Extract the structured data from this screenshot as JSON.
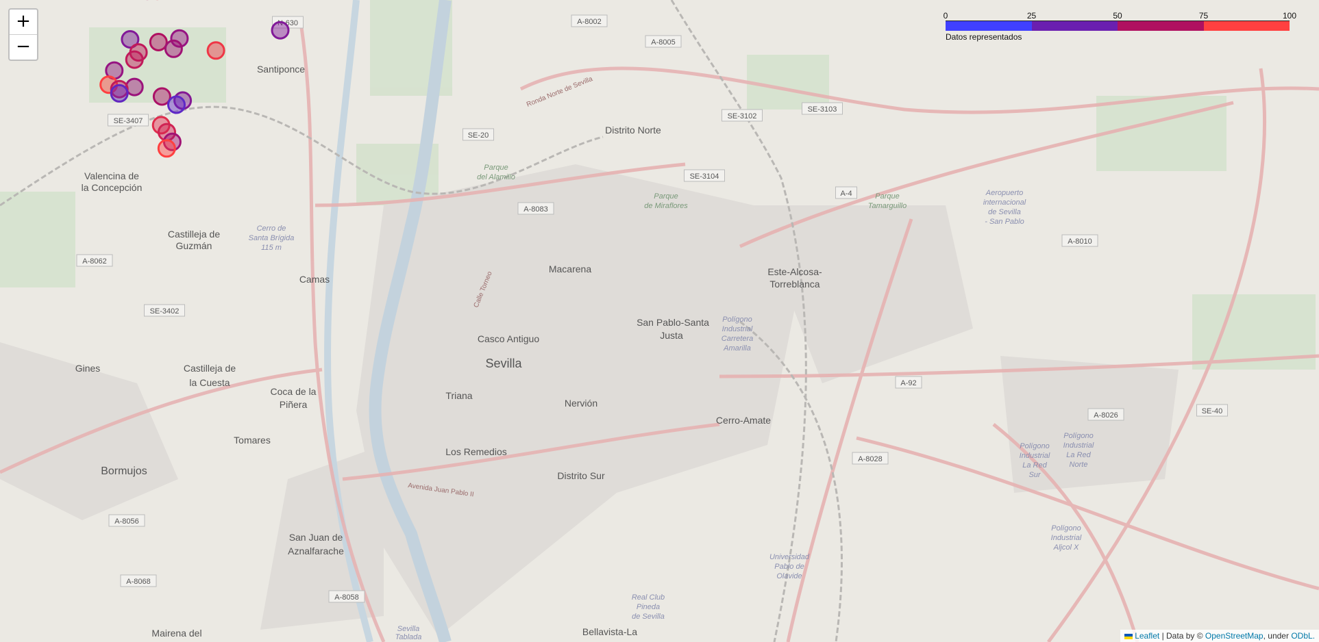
{
  "zoom": {
    "in_label": "+",
    "out_label": "−"
  },
  "legend": {
    "ticks": [
      "0",
      "25",
      "50",
      "75",
      "100"
    ],
    "caption": "Datos representados",
    "colors": [
      "#4040ff",
      "#6a1fb0",
      "#b01060",
      "#ff4040"
    ]
  },
  "attribution": {
    "leaflet": "Leaflet",
    "data_by": " | Data by © ",
    "osm": "OpenStreetMap",
    "under": ", under ",
    "odbl": "ODbL."
  },
  "places": [
    "Distrito Norte",
    "Macarena",
    "Casco Antiguo",
    "Sevilla",
    "Triana",
    "Los Remedios",
    "Nervión",
    "San Pablo-Santa",
    "Justa",
    "Este-Alcosa-",
    "Torreblanca",
    "Cerro-Amate",
    "Distrito Sur",
    "Bellavista-La",
    "Camas",
    "Santiponce",
    "Valencina de",
    "la Concepción",
    "Castilleja de",
    "Guzmán",
    "Gines",
    "Castilleja de",
    "la Cuesta",
    "Coca de la",
    "Piñera",
    "Tomares",
    "Bormujos",
    "San Juan de",
    "Aznalfarache",
    "Mairena del",
    "Parque",
    "del Alamillo",
    "Parque",
    "de Miraflores",
    "Parque",
    "Tamarguillo",
    "Aeropuerto",
    "internacional",
    "de Sevilla",
    "- San Pablo",
    "Polígono",
    "Industrial",
    "Carretera",
    "Amarilla",
    "Polígono",
    "Industrial",
    "La Red",
    "Sur",
    "Polígono",
    "Industrial",
    "La Red",
    "Norte",
    "Polígono",
    "Industrial",
    "Aljcol X",
    "Universidad",
    "Pablo de",
    "Olavide",
    "Real Club",
    "Pineda",
    "de Sevilla",
    "Cerro de",
    "Santa Brígida",
    "115 m",
    "Sevilla",
    "Tablada",
    "Avenida Juan Pablo II",
    "Ronda Norte de Sevilla",
    "Calle Torneo"
  ],
  "roads": [
    "N-630",
    "A-8002",
    "A-8005",
    "SE-3102",
    "SE-3103",
    "SE-3407",
    "SE-20",
    "SE-3104",
    "A-8083",
    "A-4",
    "A-8010",
    "A-8062",
    "SE-3402",
    "A-92",
    "A-8026",
    "SE-40",
    "A-8028",
    "A-8056",
    "A-8068",
    "A-8058"
  ],
  "markers": [
    {
      "lat": 37.4224,
      "lon": -5.9894,
      "value": 70
    },
    {
      "lat": 37.4224,
      "lon": -5.9834,
      "value": 90
    },
    {
      "lat": 37.4037,
      "lon": -5.9102,
      "value": 38
    },
    {
      "lat": 37.3998,
      "lon": -5.9702,
      "value": 50
    },
    {
      "lat": 37.3994,
      "lon": -5.9996,
      "value": 38
    },
    {
      "lat": 37.3981,
      "lon": -5.9827,
      "value": 75
    },
    {
      "lat": 37.3949,
      "lon": -5.9737,
      "value": 60
    },
    {
      "lat": 37.3941,
      "lon": -5.9485,
      "value": 95
    },
    {
      "lat": 37.3932,
      "lon": -5.9946,
      "value": 80
    },
    {
      "lat": 37.3898,
      "lon": -5.997,
      "value": 80
    },
    {
      "lat": 37.3846,
      "lon": -6.009,
      "value": 50
    },
    {
      "lat": 37.3779,
      "lon": -6.0123,
      "value": 100
    },
    {
      "lat": 37.3768,
      "lon": -5.997,
      "value": 55
    },
    {
      "lat": 37.3758,
      "lon": -6.006,
      "value": 80
    },
    {
      "lat": 37.3738,
      "lon": -6.006,
      "value": 20
    },
    {
      "lat": 37.3723,
      "lon": -5.9806,
      "value": 70
    },
    {
      "lat": 37.3704,
      "lon": -5.9683,
      "value": 40
    },
    {
      "lat": 37.3684,
      "lon": -5.972,
      "value": 18
    },
    {
      "lat": 37.3587,
      "lon": -5.9811,
      "value": 90
    },
    {
      "lat": 37.3554,
      "lon": -5.9777,
      "value": 85
    },
    {
      "lat": 37.3508,
      "lon": -5.9745,
      "value": 60
    },
    {
      "lat": 37.3477,
      "lon": -5.9778,
      "value": 100
    }
  ]
}
